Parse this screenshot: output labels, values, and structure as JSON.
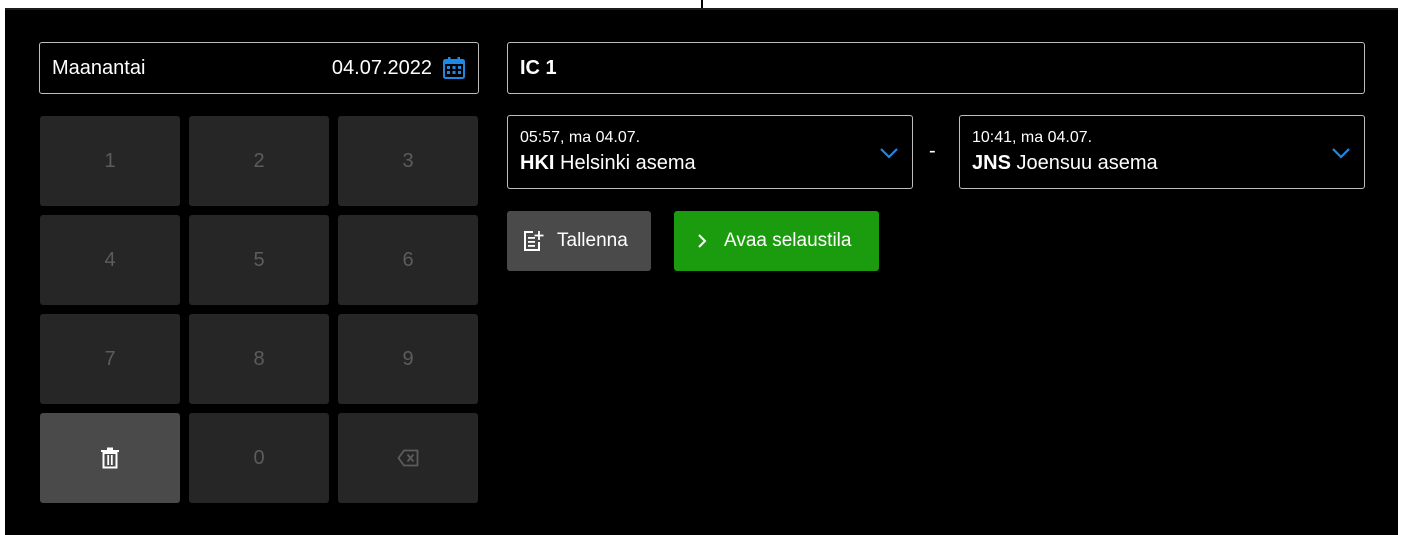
{
  "date_selector": {
    "day_label": "Maanantai",
    "date_value": "04.07.2022",
    "icon": "calendar-icon",
    "icon_color": "#1e88e5"
  },
  "keypad": {
    "keys": [
      "1",
      "2",
      "3",
      "4",
      "5",
      "6",
      "7",
      "8",
      "9"
    ],
    "zero": "0",
    "clear_icon": "trash-icon",
    "backspace_icon": "backspace-icon"
  },
  "train": {
    "value": "IC 1"
  },
  "departure": {
    "time": "05:57, ma 04.07.",
    "code": "HKI",
    "name": "Helsinki asema"
  },
  "separator": "-",
  "arrival": {
    "time": "10:41, ma 04.07.",
    "code": "JNS",
    "name": "Joensuu asema"
  },
  "actions": {
    "save_label": "Tallenna",
    "open_label": "Avaa selaustila"
  },
  "colors": {
    "accent_blue": "#1e88e5",
    "success_green": "#1b9c0e",
    "background": "#000000"
  }
}
